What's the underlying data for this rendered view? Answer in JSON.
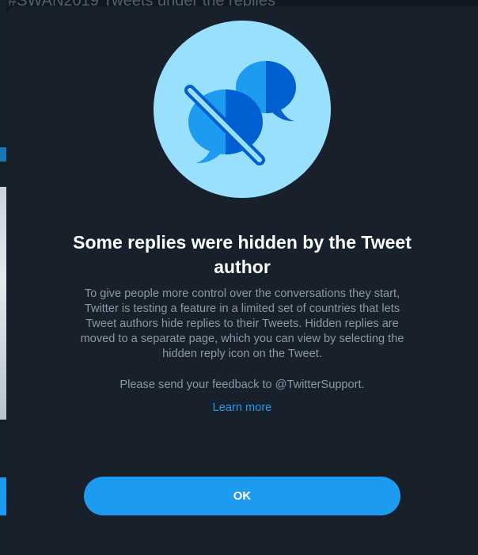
{
  "background": {
    "partial_text": "#SWAN2019 Tweets under the replies"
  },
  "dialog": {
    "illustration": "hidden-replies-illustration",
    "title": "Some replies were hidden by the Tweet author",
    "body": "To give people more control over the conversations they start, Twitter is testing a feature in a limited set of countries that lets Tweet authors hide replies to their Tweets. Hidden replies are moved to a separate page, which you can view by selecting the hidden reply icon on the Tweet.",
    "feedback": "Please send your feedback to @TwitterSupport.",
    "learn_more": "Learn more",
    "ok_label": "OK"
  },
  "colors": {
    "modal_bg": "#17202b",
    "accent": "#1d9bf0",
    "circle_bg": "#99e0ff",
    "bubble_light": "#1d9bf0",
    "bubble_dark": "#005fd1",
    "muted_text": "#8b98a5"
  }
}
